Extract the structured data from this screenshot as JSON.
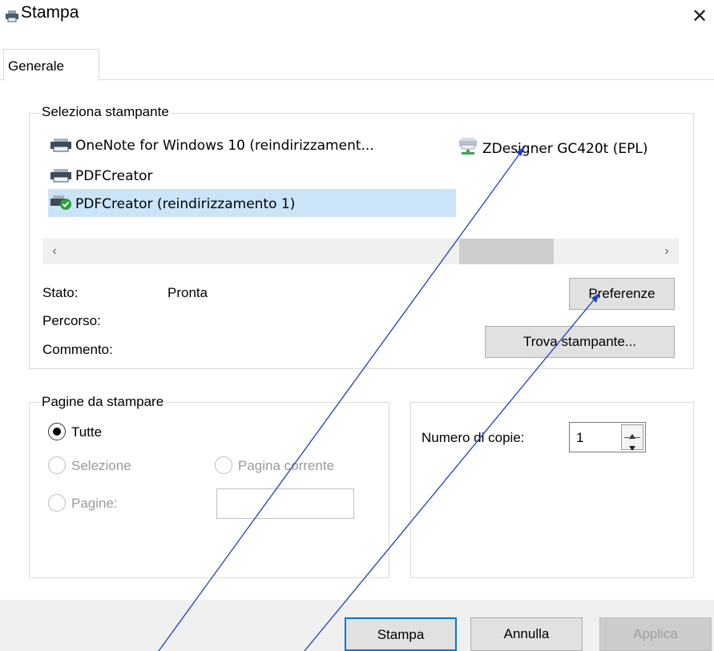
{
  "window": {
    "title": "Stampa",
    "close_glyph": "✕"
  },
  "tabs": [
    {
      "label": "Generale",
      "active": true
    }
  ],
  "printer_group": {
    "label": "Seleziona stampante",
    "printers": [
      {
        "name": "OneNote for Windows 10 (reindirizzament...",
        "icon": "printer-icon"
      },
      {
        "name": "ZDesigner GC420t (EPL)",
        "icon": "network-printer-icon"
      },
      {
        "name": "PDFCreator",
        "icon": "printer-icon"
      },
      {
        "name": "PDFCreator (reindirizzamento 1)",
        "icon": "default-printer-icon",
        "selected": true
      }
    ],
    "scroll_left": "‹",
    "scroll_right": "›",
    "status_label": "Stato:",
    "status_value": "Pronta",
    "path_label": "Percorso:",
    "comment_label": "Commento:",
    "preferences_button": "Preferenze",
    "find_printer_button": "Trova stampante..."
  },
  "pages_group": {
    "label": "Pagine da stampare",
    "all_label": "Tutte",
    "selection_label": "Selezione",
    "current_page_label": "Pagina corrente",
    "pages_label": "Pagine:",
    "pages_value": ""
  },
  "copies_group": {
    "copies_label": "Numero di copie:",
    "copies_value": "1"
  },
  "footer": {
    "print_button": "Stampa",
    "cancel_button": "Annulla",
    "apply_button": "Applica"
  },
  "colors": {
    "accent": "#0078d7",
    "selection": "#cce4f7",
    "annotation_line": "#1f3fbf"
  }
}
